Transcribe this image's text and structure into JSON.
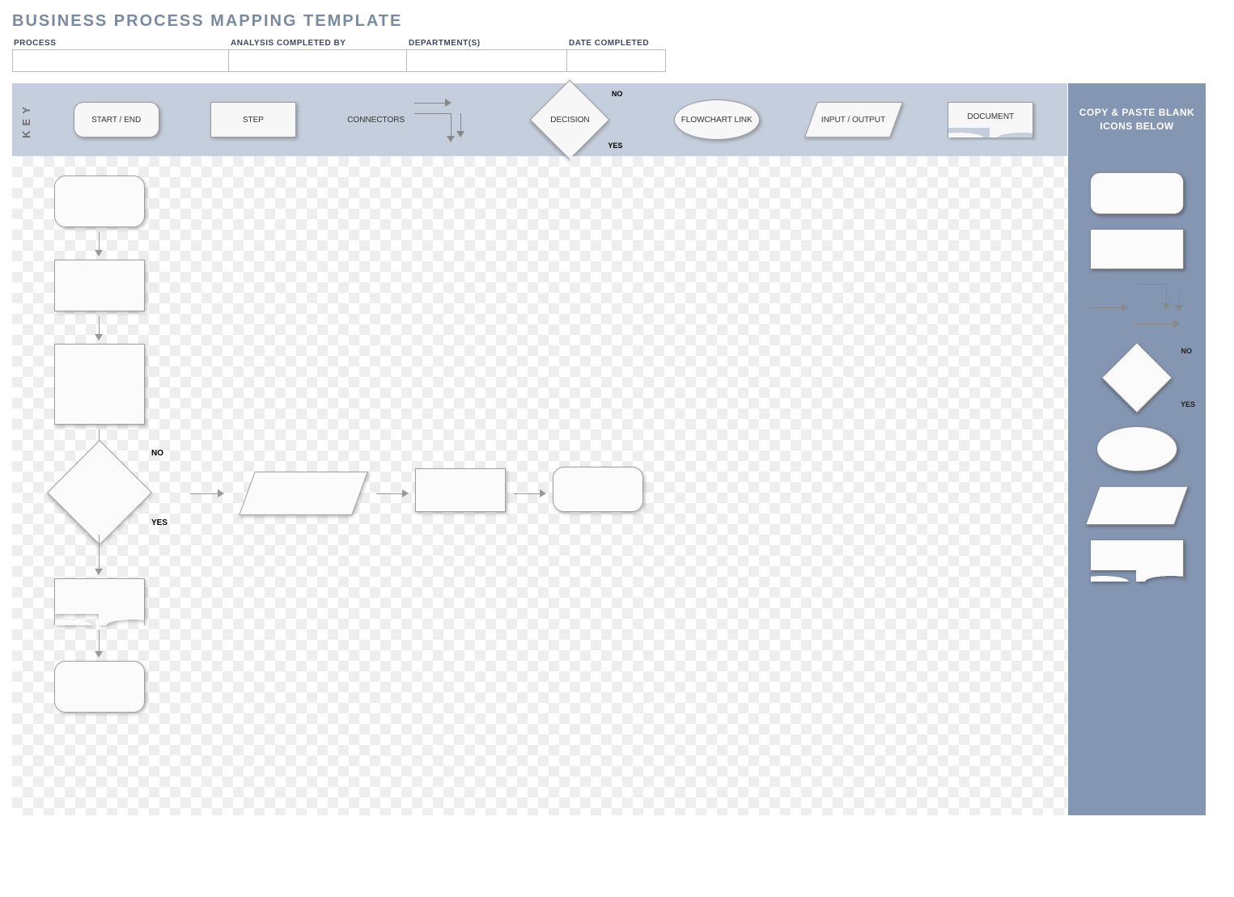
{
  "title": "BUSINESS PROCESS MAPPING TEMPLATE",
  "meta": {
    "process_label": "PROCESS",
    "process_value": "",
    "analyst_label": "ANALYSIS COMPLETED BY",
    "analyst_value": "",
    "dept_label": "DEPARTMENT(S)",
    "dept_value": "",
    "date_label": "DATE COMPLETED",
    "date_value": ""
  },
  "key": {
    "tab": "KEY",
    "startend": "START / END",
    "step": "STEP",
    "connectors": "CONNECTORS",
    "decision": "DECISION",
    "decision_no": "NO",
    "decision_yes": "YES",
    "flowchart_link": "FLOWCHART LINK",
    "io": "INPUT / OUTPUT",
    "document": "DOCUMENT"
  },
  "sidebar": {
    "header": "COPY & PASTE BLANK ICONS BELOW",
    "no": "NO",
    "yes": "YES"
  },
  "canvas": {
    "decision_no": "NO",
    "decision_yes": "YES"
  }
}
